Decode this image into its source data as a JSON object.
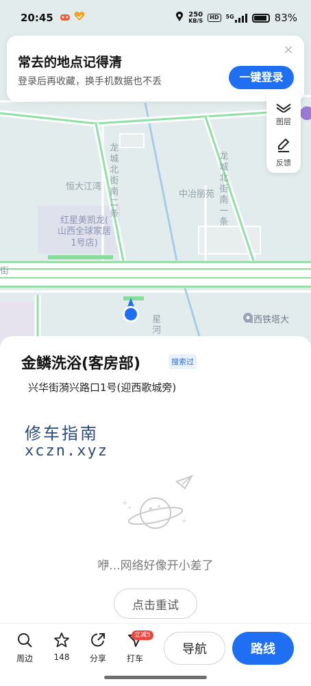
{
  "status_bar": {
    "time": "20:45",
    "net_speed_value": "250",
    "net_speed_unit": "KB/S",
    "hd": "HD",
    "network": "5G",
    "battery": "83%"
  },
  "banner": {
    "title": "常去的地点记得清",
    "subtitle": "登录后再收藏，换手机数据也不丢",
    "login_label": "一键登录"
  },
  "map_tools": {
    "layers_label": "图层",
    "feedback_label": "反馈"
  },
  "map_labels": {
    "road_left": "龙城北街南二条",
    "road_right": "龙城北街南一条",
    "area_hengda": "恒大江湾",
    "area_zhongye": "中冶丽苑",
    "poi_hongxing_l1": "红星美凯龙(",
    "poi_hongxing_l2": "山西全球家居",
    "poi_hongxing_l3": "1号店)",
    "poi_tieta": "山西铁塔大",
    "road_bottom_fragment": "星河",
    "road_left_fragment": "街"
  },
  "place": {
    "name": "金鳞洗浴(客房部)",
    "tag": "搜索过",
    "address": "兴华街漪兴路口1号(迎西歌城旁)"
  },
  "watermark": {
    "cn": "修车指南",
    "en": "xczn.xyz"
  },
  "error": {
    "message": "咿...网络好像开小差了",
    "retry_label": "点击重试"
  },
  "bottom_bar": {
    "nearby_label": "周边",
    "favorites_count": "148",
    "share_label": "分享",
    "taxi_label": "打车",
    "taxi_promo": "立减5",
    "navigate_label": "导航",
    "route_label": "路线"
  },
  "colors": {
    "primary_blue": "#1f6ff2",
    "road_green": "#7fdc97",
    "map_bg": "#e3ecec",
    "promo_red": "#f2433b"
  }
}
